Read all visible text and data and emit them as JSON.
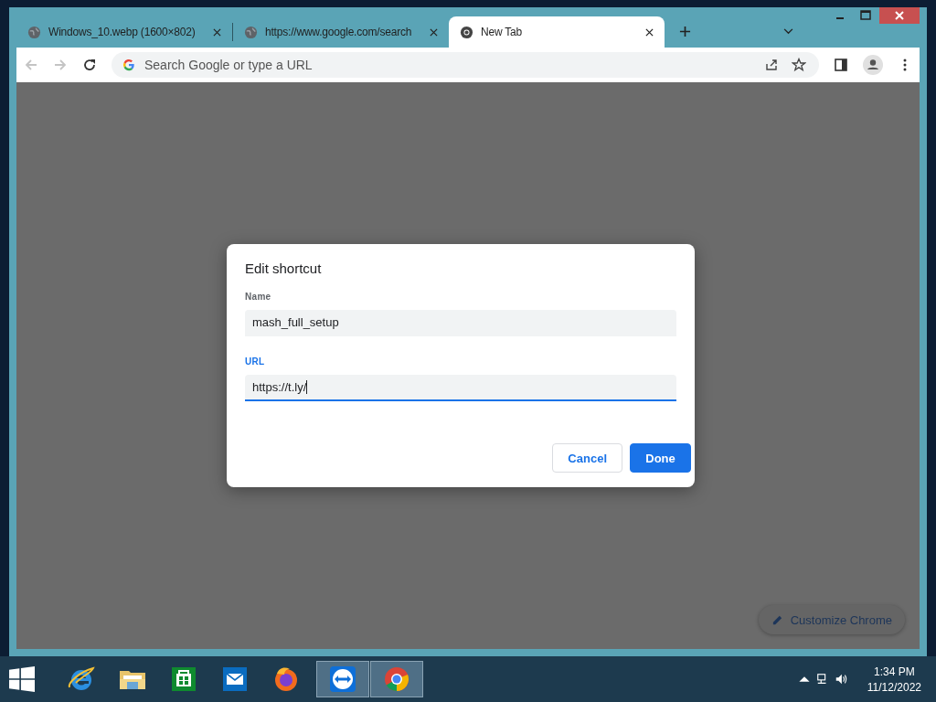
{
  "tabs": [
    {
      "title": "Windows_10.webp (1600×802)",
      "kind": "globe",
      "selected": false
    },
    {
      "title": "https://www.google.com/search",
      "kind": "globe",
      "selected": false
    },
    {
      "title": "New Tab",
      "kind": "chrome",
      "selected": true
    }
  ],
  "address_bar": {
    "placeholder": "Search Google or type a URL"
  },
  "dialog": {
    "title": "Edit shortcut",
    "fields": [
      {
        "label": "Name",
        "value": "mash_full_setup",
        "focused": false
      },
      {
        "label": "URL",
        "value": "https://t.ly/",
        "focused": true
      }
    ],
    "buttons": [
      {
        "label": "Cancel",
        "primary": false
      },
      {
        "label": "Done",
        "primary": true
      }
    ]
  },
  "customize_button": {
    "label": "Customize Chrome"
  },
  "taskbar": {
    "apps": [
      {
        "kind": "ie",
        "active": false
      },
      {
        "kind": "folder",
        "active": false
      },
      {
        "kind": "store",
        "active": false
      },
      {
        "kind": "mail",
        "active": false
      },
      {
        "kind": "firefox",
        "active": false
      },
      {
        "kind": "teamviewer",
        "active": true
      },
      {
        "kind": "chrome",
        "active": true
      }
    ],
    "time": "1:34 PM",
    "date": "11/12/2022"
  }
}
